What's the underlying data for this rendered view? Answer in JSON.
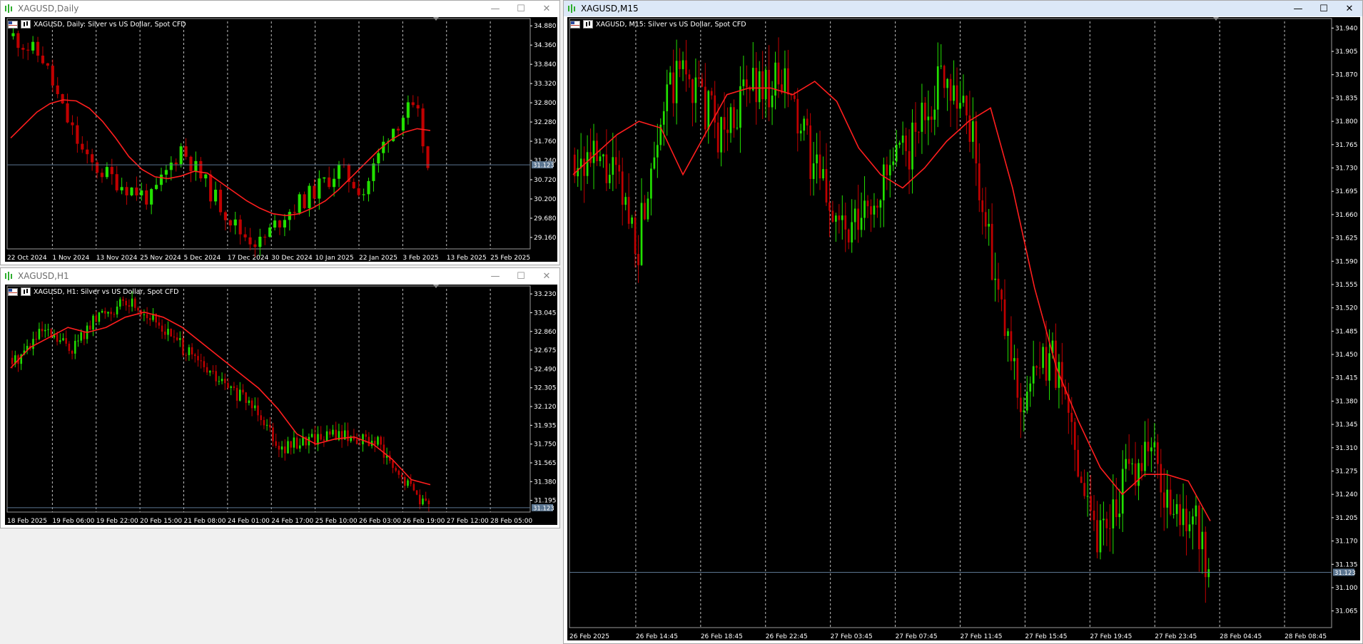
{
  "colors": {
    "bull": "#22e000",
    "bear": "#c00000",
    "ma": "#ff1e1e",
    "grid": "#ffffff",
    "bid_line": "#5b7590",
    "bid_label_bg": "#5b7590"
  },
  "windows": {
    "daily": {
      "title": "XAGUSD,Daily",
      "header": "XAGUSD, Daily:  Silver vs US Dollar, Spot CFD",
      "bid": 31.123,
      "bid_label": "31.123",
      "y_min": 28.85,
      "y_max": 35.0,
      "price_labels": [
        "34.880",
        "34.360",
        "33.840",
        "33.320",
        "32.800",
        "32.280",
        "31.760",
        "31.240",
        "30.720",
        "30.200",
        "29.680",
        "29.160"
      ],
      "time_labels": [
        "22 Oct 2024",
        "1 Nov 2024",
        "13 Nov 2024",
        "25 Nov 2024",
        "5 Dec 2024",
        "17 Dec 2024",
        "30 Dec 2024",
        "10 Jan 2025",
        "22 Jan 2025",
        "3 Feb 2025",
        "13 Feb 2025",
        "25 Feb 2025"
      ],
      "ma_points": [
        31.85,
        32.2,
        32.55,
        32.78,
        32.88,
        32.85,
        32.65,
        32.3,
        31.85,
        31.35,
        31.0,
        30.8,
        30.75,
        30.82,
        30.95,
        30.9,
        30.65,
        30.4,
        30.15,
        29.95,
        29.8,
        29.75,
        29.8,
        29.95,
        30.15,
        30.45,
        30.8,
        31.15,
        31.5,
        31.8,
        32.0,
        32.1,
        32.05
      ],
      "series": {
        "count": 85,
        "start": 34.6,
        "seed": 11,
        "vol": 0.34,
        "anchors": [
          [
            0,
            34.6
          ],
          [
            6,
            34.0
          ],
          [
            10,
            32.6
          ],
          [
            15,
            31.2
          ],
          [
            22,
            30.6
          ],
          [
            28,
            30.2
          ],
          [
            34,
            31.6
          ],
          [
            40,
            30.4
          ],
          [
            46,
            29.3
          ],
          [
            50,
            29.0
          ],
          [
            55,
            29.8
          ],
          [
            60,
            30.3
          ],
          [
            66,
            31.0
          ],
          [
            71,
            30.4
          ],
          [
            76,
            32.0
          ],
          [
            80,
            32.6
          ],
          [
            82,
            32.4
          ],
          [
            84,
            31.0
          ]
        ]
      }
    },
    "h1": {
      "title": "XAGUSD,H1",
      "header": "XAGUSD, H1:  Silver vs US Dollar, Spot CFD",
      "bid": 31.123,
      "bid_label": "31.123",
      "y_min": 31.08,
      "y_max": 33.28,
      "price_labels": [
        "33.230",
        "33.045",
        "32.860",
        "32.675",
        "32.490",
        "32.305",
        "32.120",
        "31.935",
        "31.750",
        "31.565",
        "31.380",
        "31.195"
      ],
      "time_labels": [
        "18 Feb 2025",
        "19 Feb 06:00",
        "19 Feb 22:00",
        "20 Feb 15:00",
        "21 Feb 08:00",
        "24 Feb 01:00",
        "24 Feb 17:00",
        "25 Feb 10:00",
        "26 Feb 03:00",
        "26 Feb 19:00",
        "27 Feb 12:00",
        "28 Feb 05:00"
      ],
      "ma_points": [
        32.5,
        32.7,
        32.8,
        32.9,
        32.85,
        32.9,
        33.0,
        33.05,
        33.0,
        32.9,
        32.75,
        32.6,
        32.45,
        32.3,
        32.1,
        31.85,
        31.75,
        31.8,
        31.82,
        31.75,
        31.6,
        31.4,
        31.35
      ],
      "series": {
        "count": 140,
        "start": 32.6,
        "seed": 5,
        "vol": 0.09,
        "anchors": [
          [
            0,
            32.55
          ],
          [
            10,
            32.85
          ],
          [
            20,
            32.7
          ],
          [
            30,
            33.05
          ],
          [
            40,
            33.15
          ],
          [
            50,
            32.9
          ],
          [
            62,
            32.55
          ],
          [
            72,
            32.3
          ],
          [
            82,
            32.1
          ],
          [
            90,
            31.7
          ],
          [
            98,
            31.8
          ],
          [
            108,
            31.85
          ],
          [
            116,
            31.8
          ],
          [
            122,
            31.75
          ],
          [
            128,
            31.45
          ],
          [
            134,
            31.3
          ],
          [
            139,
            31.12
          ]
        ]
      }
    },
    "m15": {
      "title": "XAGUSD,M15",
      "header": "XAGUSD, M15:  Silver vs US Dollar, Spot CFD",
      "bid": 31.123,
      "bid_label": "31.123",
      "y_min": 31.04,
      "y_max": 31.95,
      "price_labels": [
        "31.940",
        "31.905",
        "31.870",
        "31.835",
        "31.800",
        "31.765",
        "31.730",
        "31.695",
        "31.660",
        "31.625",
        "31.590",
        "31.555",
        "31.520",
        "31.485",
        "31.450",
        "31.415",
        "31.380",
        "31.345",
        "31.310",
        "31.275",
        "31.240",
        "31.205",
        "31.170",
        "31.135",
        "31.100",
        "31.065"
      ],
      "time_labels": [
        "26 Feb 2025",
        "26 Feb 14:45",
        "26 Feb 18:45",
        "26 Feb 22:45",
        "27 Feb 03:45",
        "27 Feb 07:45",
        "27 Feb 11:45",
        "27 Feb 15:45",
        "27 Feb 19:45",
        "27 Feb 23:45",
        "28 Feb 04:45",
        "28 Feb 08:45"
      ],
      "ma_points": [
        31.72,
        31.75,
        31.78,
        31.8,
        31.79,
        31.72,
        31.78,
        31.84,
        31.85,
        31.85,
        31.84,
        31.86,
        31.83,
        31.76,
        31.72,
        31.7,
        31.73,
        31.77,
        31.8,
        31.82,
        31.7,
        31.55,
        31.43,
        31.35,
        31.28,
        31.24,
        31.27,
        31.27,
        31.26,
        31.2
      ],
      "series": {
        "count": 200,
        "start": 31.75,
        "seed": 21,
        "vol": 0.045,
        "anchors": [
          [
            0,
            31.75
          ],
          [
            12,
            31.72
          ],
          [
            20,
            31.62
          ],
          [
            26,
            31.8
          ],
          [
            34,
            31.88
          ],
          [
            46,
            31.78
          ],
          [
            56,
            31.86
          ],
          [
            66,
            31.85
          ],
          [
            76,
            31.72
          ],
          [
            86,
            31.62
          ],
          [
            96,
            31.7
          ],
          [
            106,
            31.77
          ],
          [
            116,
            31.88
          ],
          [
            124,
            31.8
          ],
          [
            132,
            31.55
          ],
          [
            140,
            31.38
          ],
          [
            150,
            31.45
          ],
          [
            158,
            31.3
          ],
          [
            164,
            31.18
          ],
          [
            172,
            31.25
          ],
          [
            180,
            31.32
          ],
          [
            188,
            31.2
          ],
          [
            194,
            31.22
          ],
          [
            199,
            31.1
          ]
        ]
      }
    }
  }
}
